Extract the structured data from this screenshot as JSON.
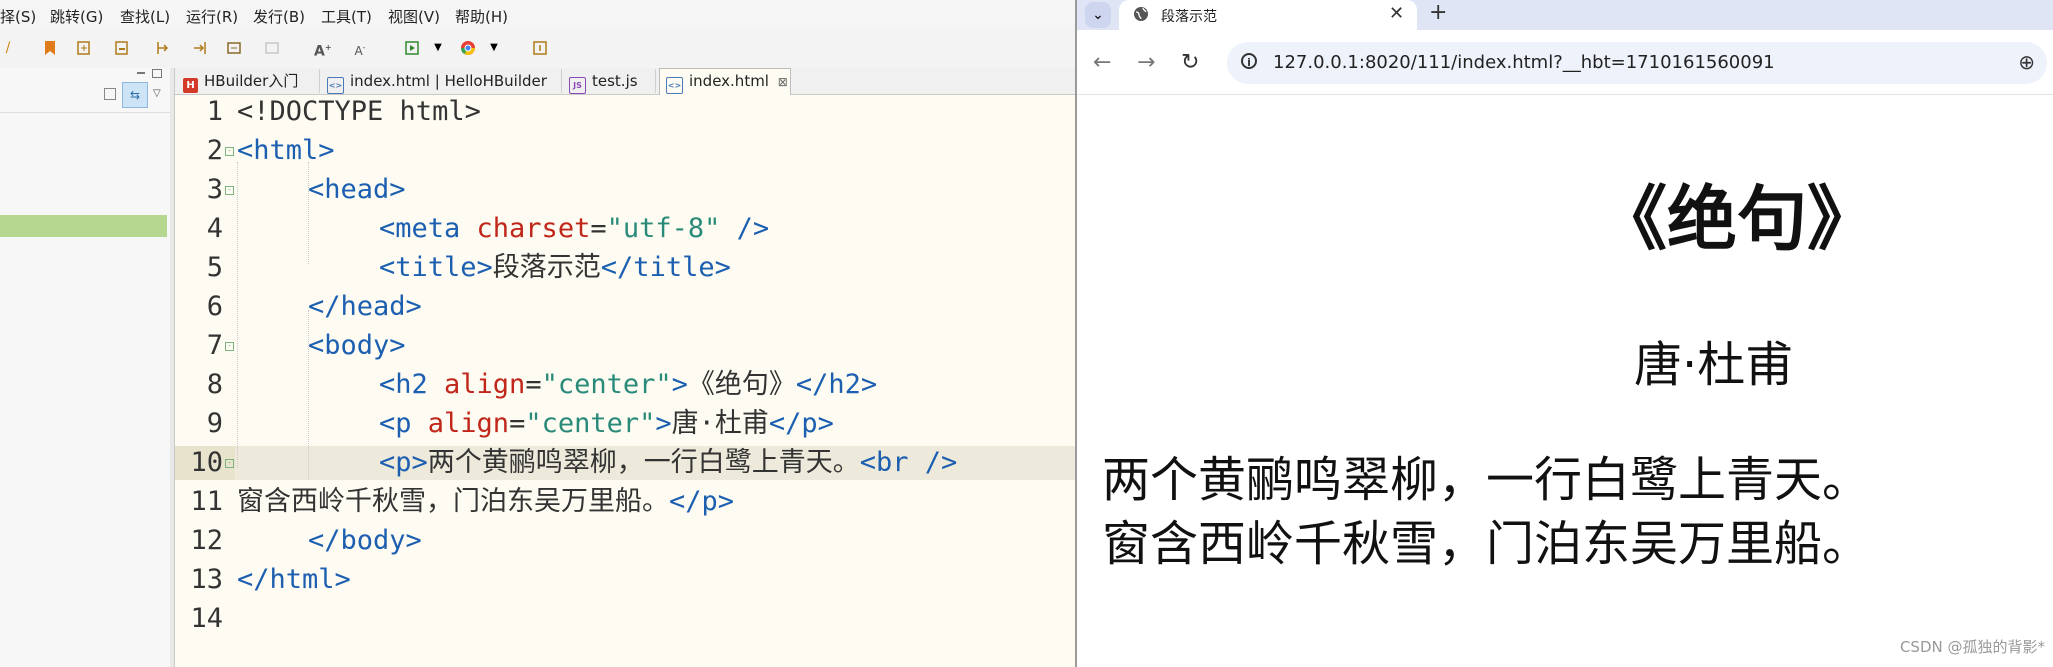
{
  "ide": {
    "menu": [
      "择(S)",
      "跳转(G)",
      "查找(L)",
      "运行(R)",
      "发行(B)",
      "工具(T)",
      "视图(V)",
      "帮助(H)"
    ],
    "tabs": [
      {
        "label": "HBuilder入门",
        "icon": "hbuilder-icon"
      },
      {
        "label": "index.html | HelloHBuilder",
        "icon": "html-file-icon"
      },
      {
        "label": "test.js",
        "icon": "js-file-icon"
      },
      {
        "label": "index.html",
        "icon": "html-file-icon",
        "close": "⊠"
      }
    ],
    "line_numbers": [
      "1",
      "2",
      "3",
      "4",
      "5",
      "6",
      "7",
      "8",
      "9",
      "10",
      "11",
      "12",
      "13",
      "14"
    ],
    "code": {
      "l1": [
        "<!DOCTYPE html>"
      ],
      "l2": [
        "<html>"
      ],
      "l3": [
        "<head>"
      ],
      "l4": [
        "<meta",
        " charset",
        "=",
        "\"utf-8\"",
        " />"
      ],
      "l5": [
        "<title>",
        "段落示范",
        "</title>"
      ],
      "l6": [
        "</head>"
      ],
      "l7": [
        "<body>"
      ],
      "l8": [
        "<h2",
        " align",
        "=",
        "\"center\"",
        ">",
        "《绝句》",
        "</h2>"
      ],
      "l9": [
        "<p",
        " align",
        "=",
        "\"center\"",
        ">",
        "唐·杜甫",
        "</p>"
      ],
      "l10": [
        "<p>",
        "两个黄鹂鸣翠柳，一行白鹭上青天。",
        "<br />"
      ],
      "l11": [
        "窗含西岭千秋雪，门泊东吴万里船。",
        "</p>"
      ],
      "l12": [
        "</body>"
      ],
      "l13": [
        "</html>"
      ]
    }
  },
  "browser": {
    "tab_title": "段落示范",
    "tab_close": "✕",
    "new_tab": "+",
    "url": "127.0.0.1:8020/111/index.html?__hbt=1710161560091",
    "page": {
      "heading": "《绝句》",
      "author": "唐·杜甫",
      "poem_line1": "两个黄鹂鸣翠柳，一行白鹭上青天。",
      "poem_line2": "窗含西岭千秋雪，门泊东吴万里船。"
    },
    "watermark": "CSDN @孤独的背影*"
  }
}
